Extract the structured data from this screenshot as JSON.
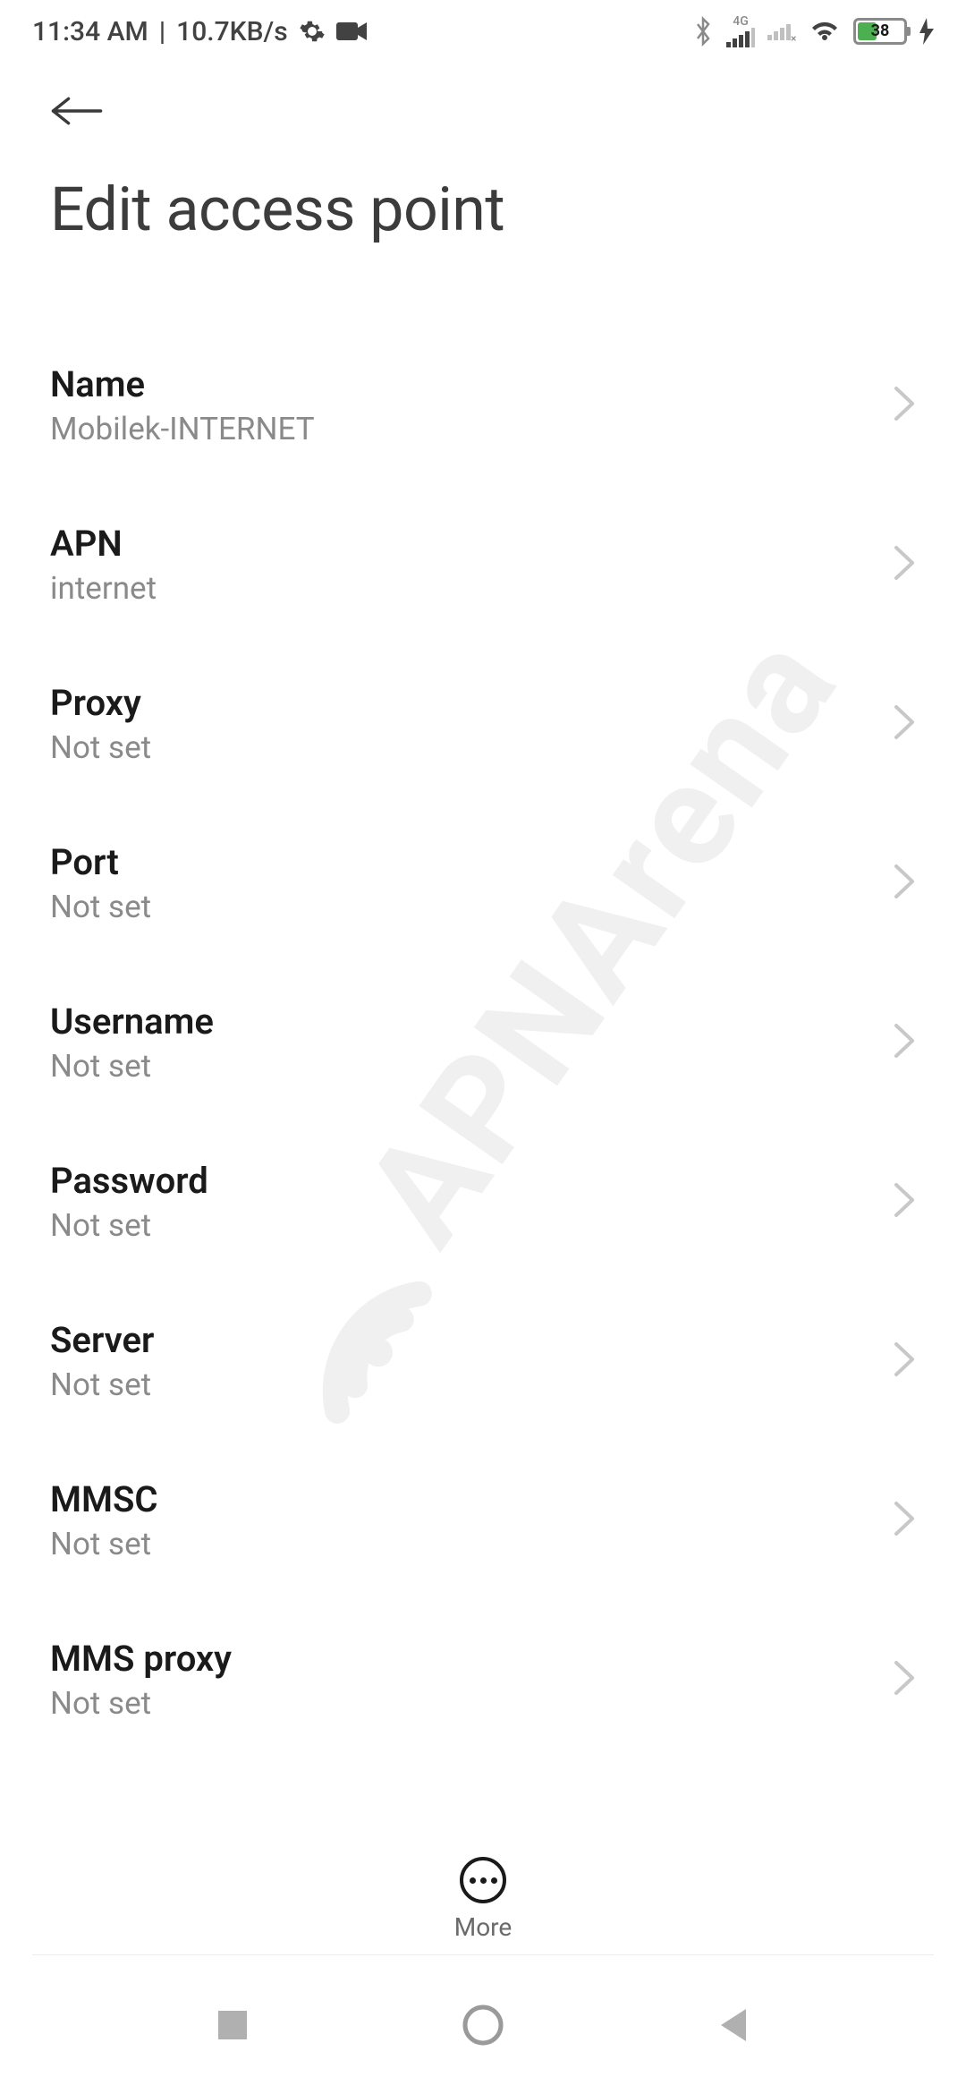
{
  "status_bar": {
    "time": "11:34 AM",
    "separator": "|",
    "data_rate": "10.7KB/s",
    "network_type": "4G",
    "battery_percent": "38"
  },
  "header": {
    "title": "Edit access point"
  },
  "settings": [
    {
      "label": "Name",
      "value": "Mobilek-INTERNET"
    },
    {
      "label": "APN",
      "value": "internet"
    },
    {
      "label": "Proxy",
      "value": "Not set"
    },
    {
      "label": "Port",
      "value": "Not set"
    },
    {
      "label": "Username",
      "value": "Not set"
    },
    {
      "label": "Password",
      "value": "Not set"
    },
    {
      "label": "Server",
      "value": "Not set"
    },
    {
      "label": "MMSC",
      "value": "Not set"
    },
    {
      "label": "MMS proxy",
      "value": "Not set"
    }
  ],
  "bottom_action": {
    "label": "More"
  },
  "watermark": {
    "text": "APNArena"
  }
}
